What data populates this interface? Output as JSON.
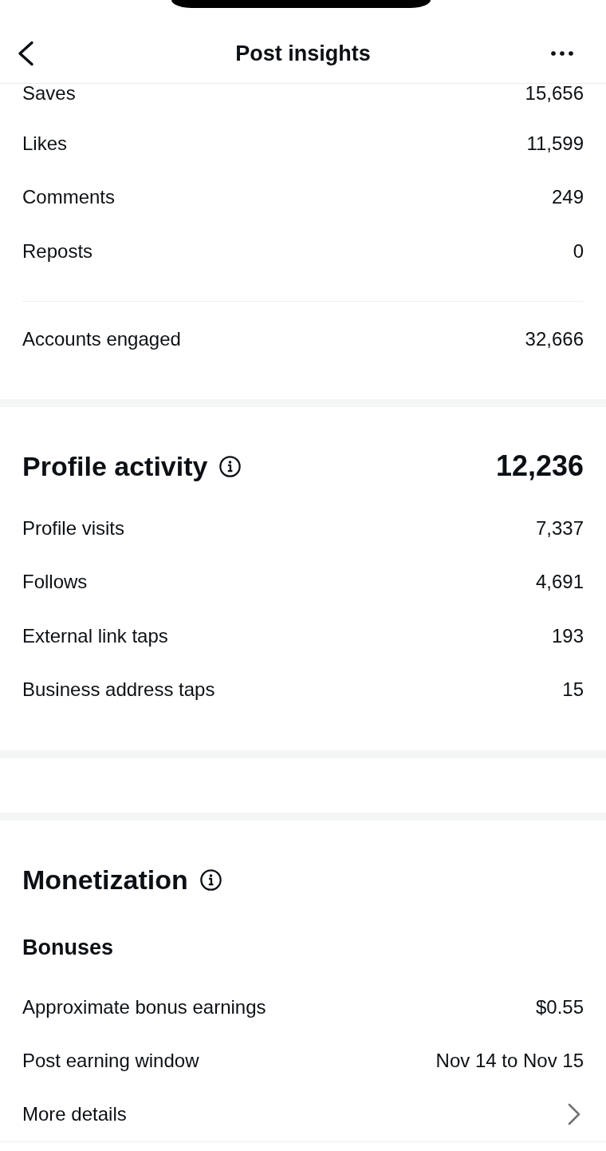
{
  "header": {
    "title": "Post insights"
  },
  "engagement": {
    "rows": [
      {
        "label": "Saves",
        "value": "15,656"
      },
      {
        "label": "Likes",
        "value": "11,599"
      },
      {
        "label": "Comments",
        "value": "249"
      },
      {
        "label": "Reposts",
        "value": "0"
      }
    ],
    "summary": {
      "label": "Accounts engaged",
      "value": "32,666"
    }
  },
  "profile_activity": {
    "title": "Profile activity",
    "total": "12,236",
    "rows": [
      {
        "label": "Profile visits",
        "value": "7,337"
      },
      {
        "label": "Follows",
        "value": "4,691"
      },
      {
        "label": "External link taps",
        "value": "193"
      },
      {
        "label": "Business address taps",
        "value": "15"
      }
    ]
  },
  "monetization": {
    "title": "Monetization",
    "subsection": "Bonuses",
    "rows": [
      {
        "kind": "value",
        "label": "Approximate bonus earnings",
        "value": "$0.55"
      },
      {
        "kind": "value",
        "label": "Post earning window",
        "value": "Nov 14 to Nov 15"
      },
      {
        "kind": "link",
        "label": "More details"
      }
    ]
  }
}
